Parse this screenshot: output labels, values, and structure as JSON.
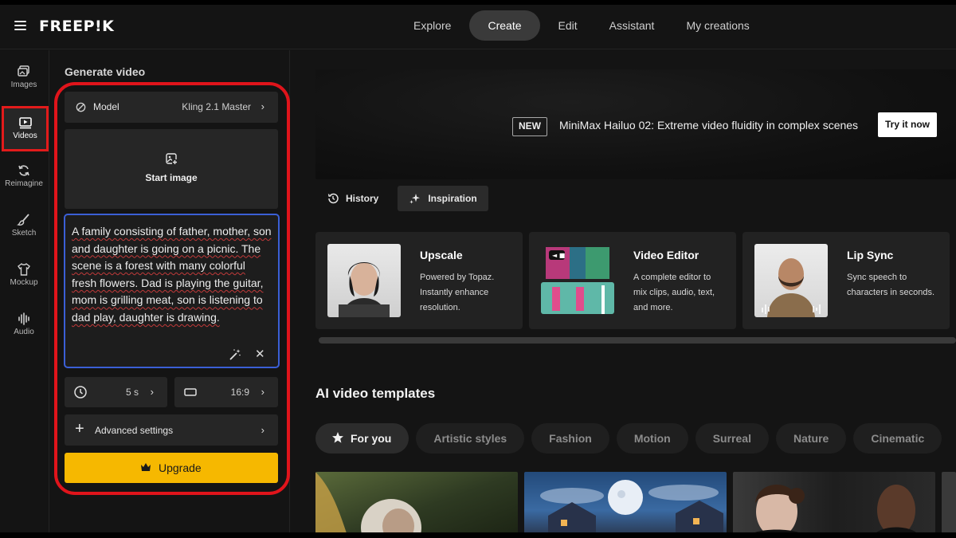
{
  "header": {
    "logo": "FREEP!K",
    "nav": [
      "Explore",
      "Create",
      "Edit",
      "Assistant",
      "My creations"
    ],
    "active_nav": "Create"
  },
  "rail": {
    "items": [
      {
        "label": "Images",
        "icon": "images-icon"
      },
      {
        "label": "Videos",
        "icon": "video-icon"
      },
      {
        "label": "Reimagine",
        "icon": "reimagine-icon"
      },
      {
        "label": "Sketch",
        "icon": "brush-icon"
      },
      {
        "label": "Mockup",
        "icon": "shirt-icon"
      },
      {
        "label": "Audio",
        "icon": "audio-wave-icon"
      }
    ],
    "selected": "Videos"
  },
  "panel": {
    "title": "Generate video",
    "model_label": "Model",
    "model_value": "Kling 2.1 Master",
    "start_image_label": "Start image",
    "prompt": "A family consisting of father, mother, son and daughter is going on a picnic. The scene is a forest with many colorful fresh flowers. Dad is playing the guitar, mom is grilling meat, son is listening to dad play, daughter is drawing.",
    "duration": "5 s",
    "aspect_ratio": "16:9",
    "advanced_label": "Advanced settings",
    "upgrade_label": "Upgrade"
  },
  "banner": {
    "badge": "NEW",
    "text": "MiniMax Hailuo 02: Extreme video fluidity in complex scenes",
    "cta": "Try it now"
  },
  "tabs": [
    "History",
    "Inspiration"
  ],
  "active_tab": "Inspiration",
  "features": [
    {
      "title": "Upscale",
      "description": "Powered by Topaz. Instantly enhance resolution."
    },
    {
      "title": "Video Editor",
      "description": "A complete editor to mix clips, audio, text, and more."
    },
    {
      "title": "Lip Sync",
      "description": "Sync speech to characters in seconds."
    }
  ],
  "templates": {
    "title": "AI video templates",
    "chips": [
      "For you",
      "Artistic styles",
      "Fashion",
      "Motion",
      "Surreal",
      "Nature",
      "Cinematic"
    ],
    "active_chip": "For you"
  },
  "colors": {
    "accent_yellow": "#f6b800",
    "highlight_red": "#e0141b",
    "focus_blue": "#3b5fd6"
  }
}
